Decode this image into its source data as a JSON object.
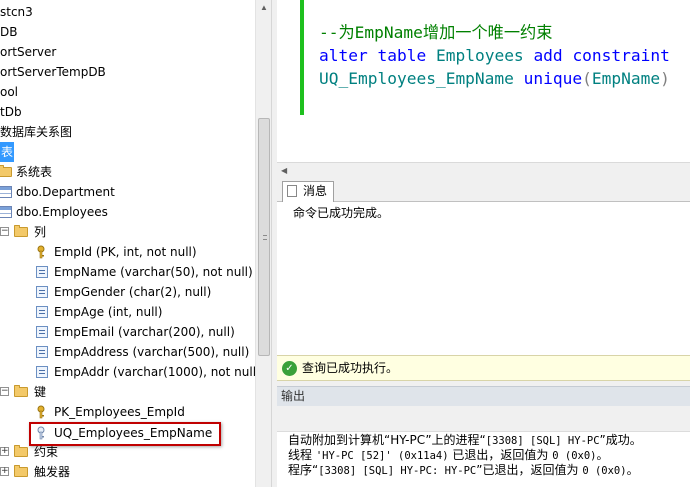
{
  "object_explorer": {
    "items": [
      {
        "label": "stcn3"
      },
      {
        "label": "DB"
      },
      {
        "label": "ortServer"
      },
      {
        "label": "ortServerTempDB"
      },
      {
        "label": "ool"
      },
      {
        "label": "tDb"
      },
      {
        "label": "数据库关系图"
      },
      {
        "label": "表"
      },
      {
        "label": "系统表"
      },
      {
        "label": "dbo.Department"
      },
      {
        "label": "dbo.Employees"
      },
      {
        "label": "列"
      },
      {
        "label": "EmpId (PK, int, not null)"
      },
      {
        "label": "EmpName (varchar(50), not null)"
      },
      {
        "label": "EmpGender (char(2), null)"
      },
      {
        "label": "EmpAge (int, null)"
      },
      {
        "label": "EmpEmail (varchar(200), null)"
      },
      {
        "label": "EmpAddress (varchar(500), null)"
      },
      {
        "label": "EmpAddr (varchar(1000), not null)"
      },
      {
        "label": "键"
      },
      {
        "label": "PK_Employees_EmpId"
      },
      {
        "label": "UQ_Employees_EmpName"
      },
      {
        "label": "约束"
      },
      {
        "label": "触发器"
      }
    ]
  },
  "editor": {
    "comment": "--为EmpName增加一个唯一约束",
    "line2": {
      "kw1": "alter",
      "kw2": "table",
      "table": "Employees",
      "kw3": "add",
      "kw4": "constraint"
    },
    "line3": {
      "name": "UQ_Employees_EmpName",
      "kw": "unique",
      "open": "(",
      "col": "EmpName",
      "close": ")"
    }
  },
  "results": {
    "tab_label": "消息",
    "message": "命令已成功完成。"
  },
  "status": {
    "text": "查询已成功执行。"
  },
  "output": {
    "title": "输出",
    "lines": [
      {
        "a": "自动附加到计算机“HY-PC”上的进程“",
        "b": "[3308] [SQL] HY-PC",
        "c": "”成功。"
      },
      {
        "a": "线程 ",
        "b": "'HY-PC [52]' (0x11a4)",
        "c": " 已退出，返回值为 ",
        "d": "0 (0x0)",
        "e": "。"
      },
      {
        "a": "程序“",
        "b": "[3308] [SQL] HY-PC: HY-PC",
        "c": "”已退出，返回值为 ",
        "d": "0 (0x0)",
        "e": "。"
      }
    ]
  },
  "colors": {
    "keyword": "#0000ff",
    "comment": "#008000",
    "identifier": "#008080",
    "selection": "#3399ff",
    "highlight_box": "#c00000",
    "change_bar": "#1ec01e"
  }
}
